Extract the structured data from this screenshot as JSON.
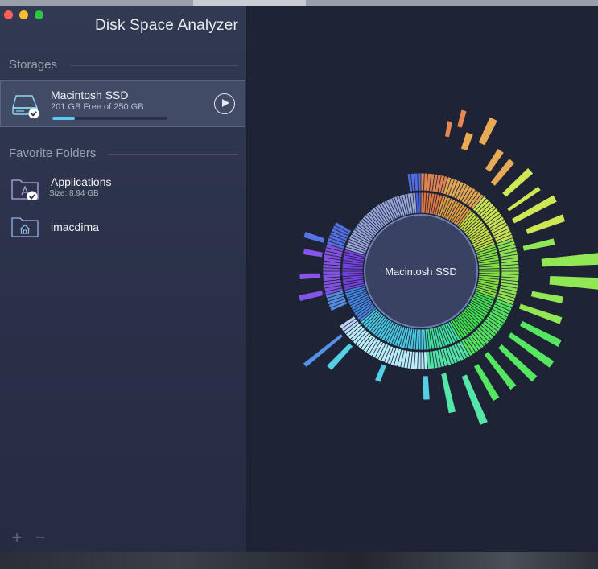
{
  "app": {
    "title": "Disk Space Analyzer"
  },
  "sidebar": {
    "storages_header": "Storages",
    "storage": {
      "name": "Macintosh SSD",
      "free_text": "201 GB Free of 250 GB",
      "used_fraction": 0.196,
      "icon": "drive-icon"
    },
    "favorites_header": "Favorite Folders",
    "favorites": [
      {
        "name": "Applications",
        "size": "Size: 8.94 GB",
        "icon": "applications-folder-icon"
      },
      {
        "name": "imacdima",
        "size": "",
        "icon": "home-folder-icon"
      }
    ],
    "add_label": "+",
    "remove_label": "−"
  },
  "main": {
    "center_label": "Macintosh SSD"
  },
  "colors": {
    "accent": "#5ec8f2",
    "sidebar_bg": "#2c3346",
    "main_bg": "#1e2436"
  }
}
